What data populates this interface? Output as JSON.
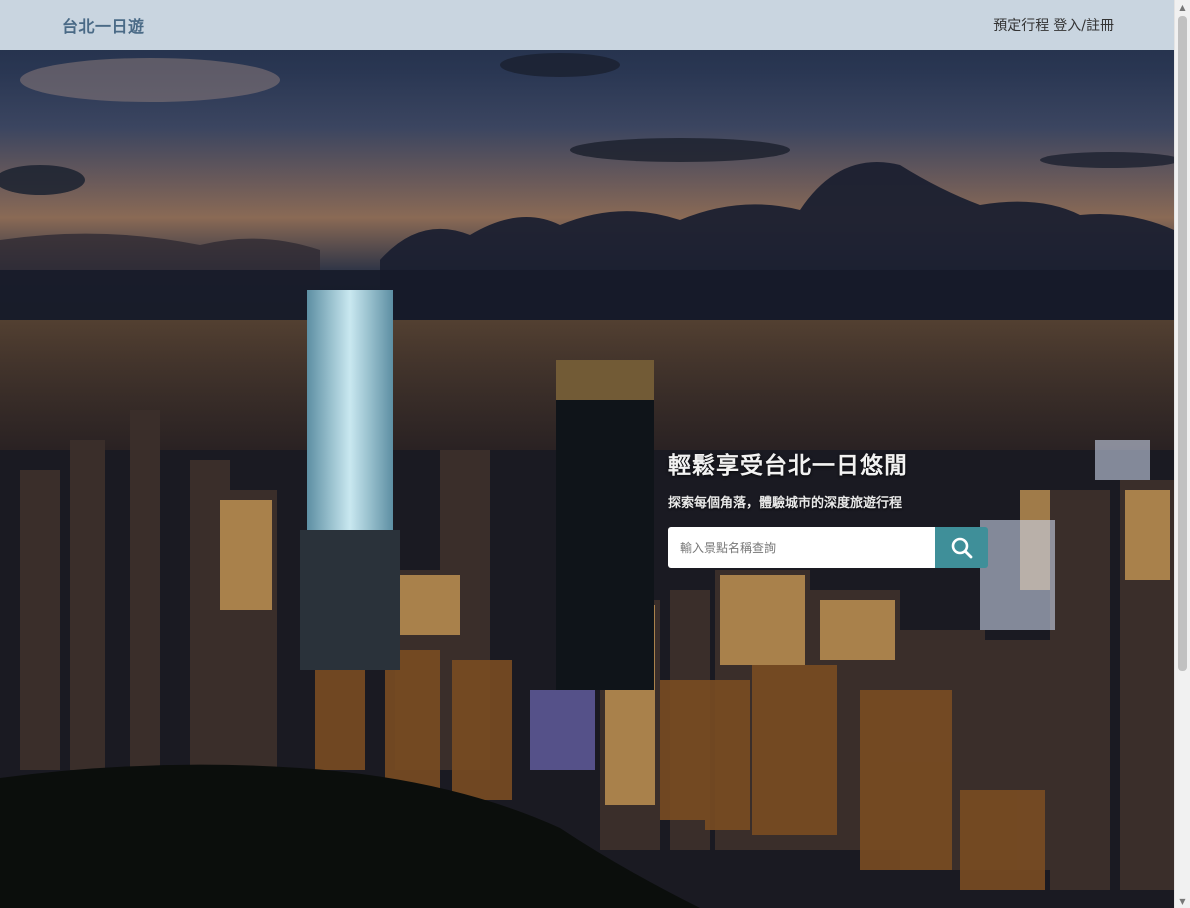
{
  "navbar": {
    "brand": "台北一日遊",
    "links": [
      {
        "label": "預定行程"
      },
      {
        "label": "登入/註冊"
      }
    ]
  },
  "hero": {
    "title": "輕鬆享受台北一日悠閒",
    "subtitle": "探索每個角落，體驗城市的深度旅遊行程",
    "background": "taipei-101-night-skyline"
  },
  "search": {
    "placeholder": "輸入景點名稱查詢",
    "value": "",
    "button_icon": "search-icon"
  },
  "colors": {
    "navbar_bg": "#d6e2ec",
    "brand": "#4a6a86",
    "search_button": "#3f8f99",
    "hero_text": "#f2f2f2"
  }
}
